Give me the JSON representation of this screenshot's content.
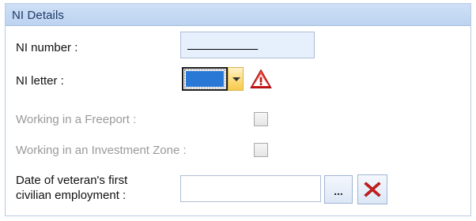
{
  "panel": {
    "title": "NI Details"
  },
  "fields": {
    "ni_number": {
      "label": "NI number :",
      "value": "__________"
    },
    "ni_letter": {
      "label": "NI letter :",
      "value": ""
    },
    "freeport": {
      "label": "Working in a Freeport :",
      "checked": false,
      "disabled": true
    },
    "investment_zone": {
      "label": "Working in an Investment Zone :",
      "checked": false,
      "disabled": true
    },
    "veteran_date": {
      "label_line1": "Date of veteran's first",
      "label_line2": "civilian employment :",
      "value": "",
      "browse_label": "..."
    }
  },
  "icons": {
    "warning": "warning-icon",
    "dropdown": "chevron-down-icon",
    "clear": "close-icon"
  },
  "colors": {
    "header_bg": "#c6daf3",
    "header_text": "#1f3a67",
    "selection_blue": "#2a78d6",
    "warning_red": "#e02424",
    "clear_red": "#d51f1f",
    "disabled_text": "#9a9a9a",
    "input_bg": "#e6f0fd"
  }
}
